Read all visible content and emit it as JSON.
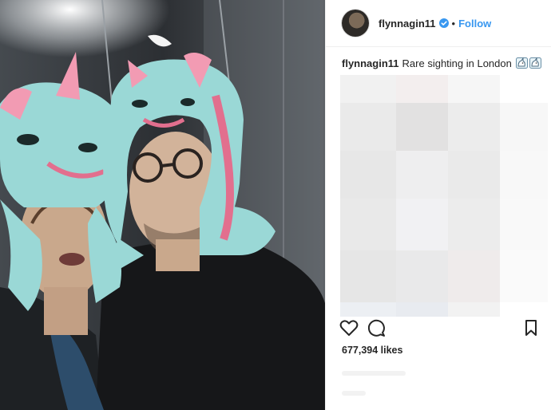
{
  "post": {
    "username": "flynnagin11",
    "verified": true,
    "follow_label": "Follow",
    "separator": "•",
    "caption_user": "flynnagin11",
    "caption_text": "Rare sighting in London",
    "caption_emojis": [
      "unicorn-icon",
      "unicorn-icon"
    ],
    "likes": "677,394 likes"
  },
  "icons": {
    "like": "heart-outline-icon",
    "comment": "comment-bubble-icon",
    "save": "bookmark-outline-icon",
    "verified": "verified-badge-icon"
  },
  "colors": {
    "accent": "#3897f0",
    "text": "#262626",
    "border": "#efefef",
    "unicorn_hood": "#9ad8d6",
    "unicorn_horn": "#f29bb3"
  }
}
